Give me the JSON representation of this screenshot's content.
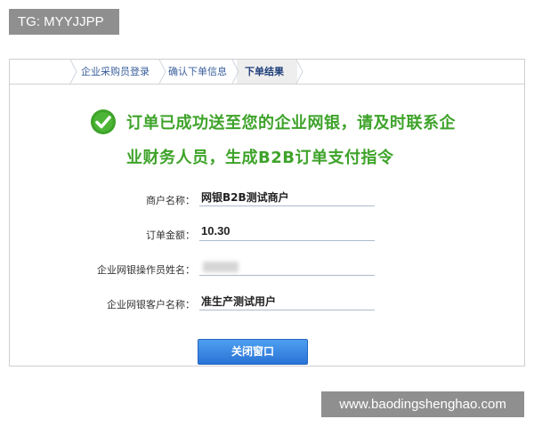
{
  "tag_badge": "TG: MYYJJPP",
  "steps": {
    "step1": "企业采购员登录",
    "step2": "确认下单信息",
    "step3": "下单结果"
  },
  "success": {
    "line1": "订单已成功送至您的企业网银，请及时联系企",
    "line2": "业财务人员，生成B2B订单支付指令"
  },
  "form": {
    "merchant_label": "商户名称：",
    "merchant_value": "网银B2B测试商户",
    "amount_label": "订单金额：",
    "amount_value": "10.30",
    "operator_label": "企业网银操作员姓名：",
    "customer_label": "企业网银客户名称：",
    "customer_value": "准生产测试用户"
  },
  "buttons": {
    "close": "关闭窗口"
  },
  "watermark": "www.baodingshenghao.com",
  "colors": {
    "success_green": "#3ea32a",
    "button_blue": "#2a73d6",
    "step_link": "#3a5f9c"
  }
}
